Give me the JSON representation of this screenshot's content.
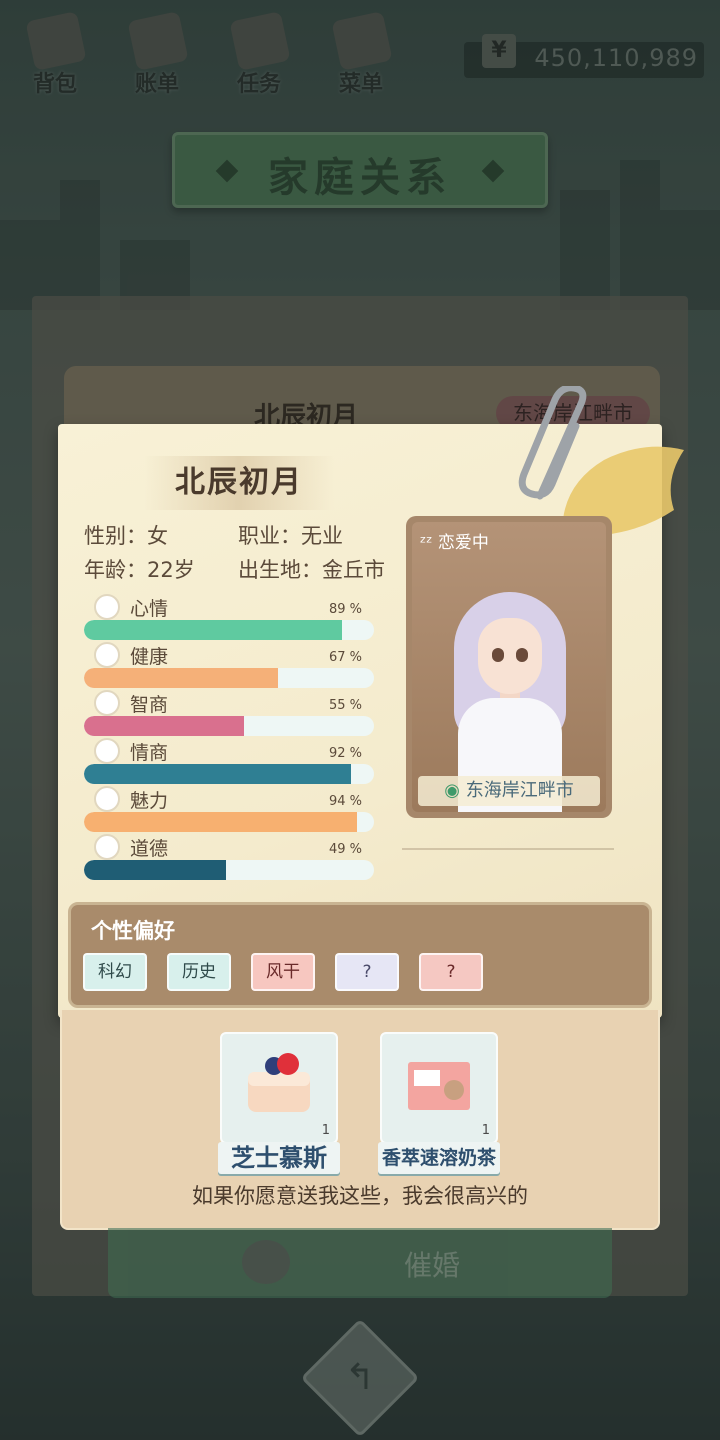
{
  "topbar": {
    "nav": [
      {
        "label": "背包",
        "icon": "backpack-icon"
      },
      {
        "label": "账单",
        "icon": "bill-icon"
      },
      {
        "label": "任务",
        "icon": "task-icon"
      },
      {
        "label": "菜单",
        "icon": "menu-icon"
      }
    ],
    "money": {
      "symbol": "¥",
      "amount": "450,110,989"
    }
  },
  "page_title": "家庭关系",
  "back_card": {
    "name": "北辰初月",
    "location_tag": "东海岸江畔市"
  },
  "profile": {
    "name": "北辰初月",
    "gender_label": "性别：女",
    "job_label": "职业：无业",
    "age_label": "年龄：22岁",
    "birthplace_label": "出生地：金丘市",
    "status": "恋爱中",
    "location": "东海岸江畔市",
    "stats": [
      {
        "name": "心情",
        "value": 89,
        "pct_text": "89 %",
        "color": "#5fcaa0",
        "icon": "smile-icon"
      },
      {
        "name": "健康",
        "value": 67,
        "pct_text": "67 %",
        "color": "#f5b078",
        "icon": "heart-icon"
      },
      {
        "name": "智商",
        "value": 55,
        "pct_text": "55 %",
        "color": "#d9708e",
        "icon": "bulb-icon"
      },
      {
        "name": "情商",
        "value": 92,
        "pct_text": "92 %",
        "color": "#2f7f93",
        "icon": "apple-icon"
      },
      {
        "name": "魅力",
        "value": 94,
        "pct_text": "94 %",
        "color": "#f7b070",
        "icon": "sparkle-icon"
      },
      {
        "name": "道德",
        "value": 49,
        "pct_text": "49 %",
        "color": "#1f5d74",
        "icon": "scale-icon"
      }
    ]
  },
  "preferences": {
    "title": "个性偏好",
    "items": [
      {
        "label": "科幻",
        "bg": "#d8f0ec",
        "fg": "#2f4a4a"
      },
      {
        "label": "历史",
        "bg": "#d8f0ec",
        "fg": "#2f4a4a"
      },
      {
        "label": "风干",
        "bg": "#f7c7c0",
        "fg": "#6a2a2a"
      },
      {
        "label": "?",
        "bg": "#e6e6f5",
        "fg": "#4a4a6a"
      },
      {
        "label": "?",
        "bg": "#f5c8c2",
        "fg": "#6a2a2a"
      }
    ]
  },
  "gifts": {
    "items": [
      {
        "name": "芝士慕斯",
        "count": "1",
        "icon": "cheese-mousse-icon"
      },
      {
        "name": "香萃速溶奶茶",
        "count": "1",
        "icon": "milk-tea-box-icon"
      }
    ],
    "message": "如果你愿意送我这些，我会很高兴的"
  },
  "actions": {
    "urge_marriage": "催婚"
  }
}
